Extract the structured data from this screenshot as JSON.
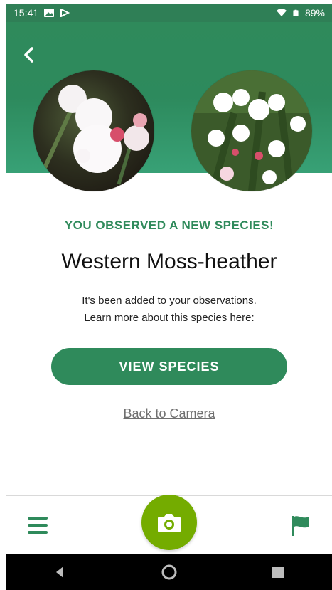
{
  "status": {
    "time": "15:41",
    "battery": "89%"
  },
  "colors": {
    "primary_green": "#2f8a5b",
    "camera_green": "#74ac00",
    "header_green": "#2f8a5b"
  },
  "header": {
    "back_icon": "chevron-left-icon"
  },
  "photos": {
    "left": "species-photo-1",
    "right": "species-photo-2"
  },
  "main": {
    "eyebrow": "YOU OBSERVED A NEW SPECIES!",
    "species_name": "Western Moss-heather",
    "message_line1": "It's been added to your observations.",
    "message_line2": "Learn more about this species here:",
    "cta_label": "VIEW SPECIES",
    "back_link": "Back to Camera"
  },
  "bottombar": {
    "menu_icon": "hamburger-menu-icon",
    "camera_icon": "camera-icon",
    "flag_icon": "flag-icon"
  },
  "navbar": {
    "back_icon": "android-back-icon",
    "home_icon": "android-home-icon",
    "recents_icon": "android-recents-icon"
  }
}
